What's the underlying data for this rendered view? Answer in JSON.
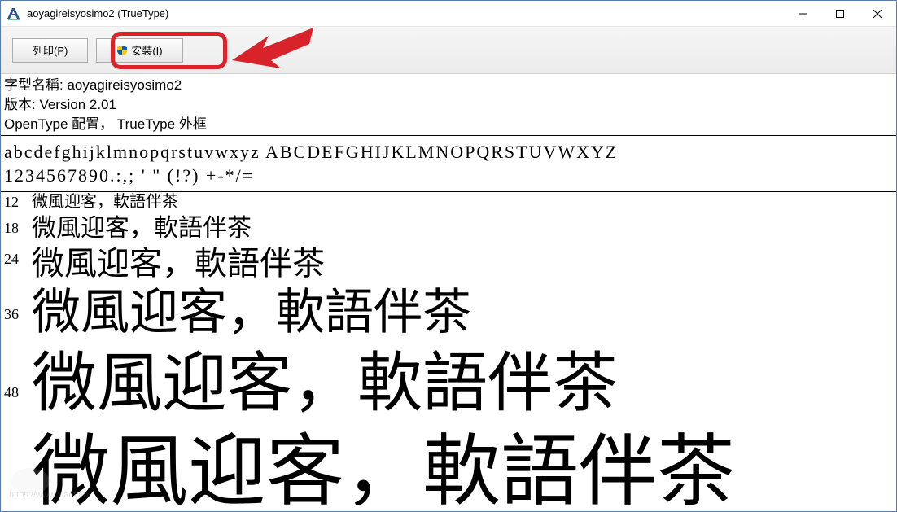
{
  "window": {
    "title": "aoyagireisyosimo2 (TrueType)"
  },
  "toolbar": {
    "print_label": "列印(P)",
    "install_label": "安裝(I)"
  },
  "font_info": {
    "name_label": "字型名稱: aoyagireisyosimo2",
    "version_label": "版本: Version 2.01",
    "opentype_label": "OpenType 配置， TrueType 外框"
  },
  "charset": {
    "line1": "abcdefghijklmnopqrstuvwxyz ABCDEFGHIJKLMNOPQRSTUVWXYZ",
    "line2": "1234567890.:,; ' \" (!?) +-*/="
  },
  "samples": [
    {
      "size": "12",
      "cls": "s12",
      "text": "微風迎客，軟語伴茶"
    },
    {
      "size": "18",
      "cls": "s18",
      "text": "微風迎客，軟語伴茶"
    },
    {
      "size": "24",
      "cls": "s24",
      "text": "微風迎客，軟語伴茶"
    },
    {
      "size": "36",
      "cls": "s36",
      "text": "微風迎客，軟語伴茶"
    },
    {
      "size": "48",
      "cls": "s48",
      "text": "微風迎客，軟語伴茶"
    },
    {
      "size": "",
      "cls": "s60",
      "text": "微風迎客，軟語伴茶"
    }
  ]
}
